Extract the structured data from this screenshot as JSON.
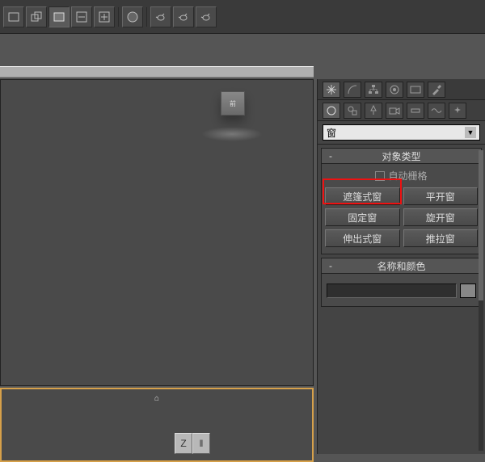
{
  "toolbar": {
    "icons": [
      "box",
      "boxes",
      "layers",
      "monitor",
      "monitor2",
      "torus",
      "teapot1",
      "teapot2",
      "teapot3"
    ]
  },
  "viewport": {
    "cube_label": "前"
  },
  "axis": {
    "z": "Z",
    "bar": "‖"
  },
  "panel": {
    "dropdown_value": "窗",
    "rollout_object_type": "对象类型",
    "autogrid_label": "自动栅格",
    "types": [
      "遮篷式窗",
      "平开窗",
      "固定窗",
      "旋开窗",
      "伸出式窗",
      "推拉窗"
    ],
    "rollout_name_color": "名称和颜色"
  }
}
